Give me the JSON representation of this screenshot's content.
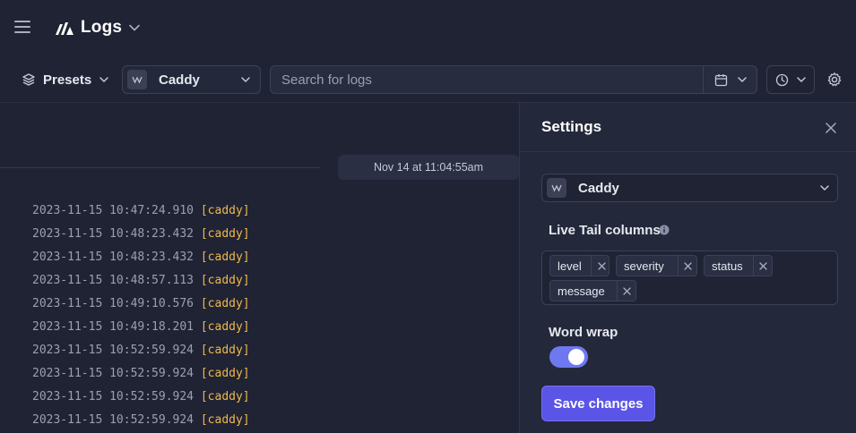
{
  "header": {
    "brand": "Logs"
  },
  "toolbar": {
    "presets_label": "Presets",
    "source_label": "Caddy",
    "search_placeholder": "Search for logs"
  },
  "logs": {
    "date_marker": "Nov 14 at 11:04:55am",
    "rows": [
      {
        "time": "2023-11-15 10:47:24.910",
        "source": "[caddy]"
      },
      {
        "time": "2023-11-15 10:48:23.432",
        "source": "[caddy]"
      },
      {
        "time": "2023-11-15 10:48:23.432",
        "source": "[caddy]"
      },
      {
        "time": "2023-11-15 10:48:57.113",
        "source": "[caddy]"
      },
      {
        "time": "2023-11-15 10:49:10.576",
        "source": "[caddy]"
      },
      {
        "time": "2023-11-15 10:49:18.201",
        "source": "[caddy]"
      },
      {
        "time": "2023-11-15 10:52:59.924",
        "source": "[caddy]"
      },
      {
        "time": "2023-11-15 10:52:59.924",
        "source": "[caddy]"
      },
      {
        "time": "2023-11-15 10:52:59.924",
        "source": "[caddy]"
      },
      {
        "time": "2023-11-15 10:52:59.924",
        "source": "[caddy]"
      }
    ]
  },
  "settings": {
    "title": "Settings",
    "source_label": "Caddy",
    "columns_label": "Live Tail columns",
    "columns": [
      "level",
      "severity",
      "status",
      "message"
    ],
    "word_wrap_label": "Word wrap",
    "word_wrap_enabled": true,
    "save_label": "Save changes"
  },
  "colors": {
    "background": "#1f2334",
    "panel": "#23283a",
    "accent": "#5a55e6",
    "toggle": "#6e78f0",
    "source_tag": "#f0b84a"
  },
  "icons": [
    "hamburger-icon",
    "logs-logo-icon",
    "chevron-down-icon",
    "layers-icon",
    "source-icon",
    "calendar-icon",
    "clock-icon",
    "gear-icon",
    "close-icon",
    "info-icon"
  ]
}
